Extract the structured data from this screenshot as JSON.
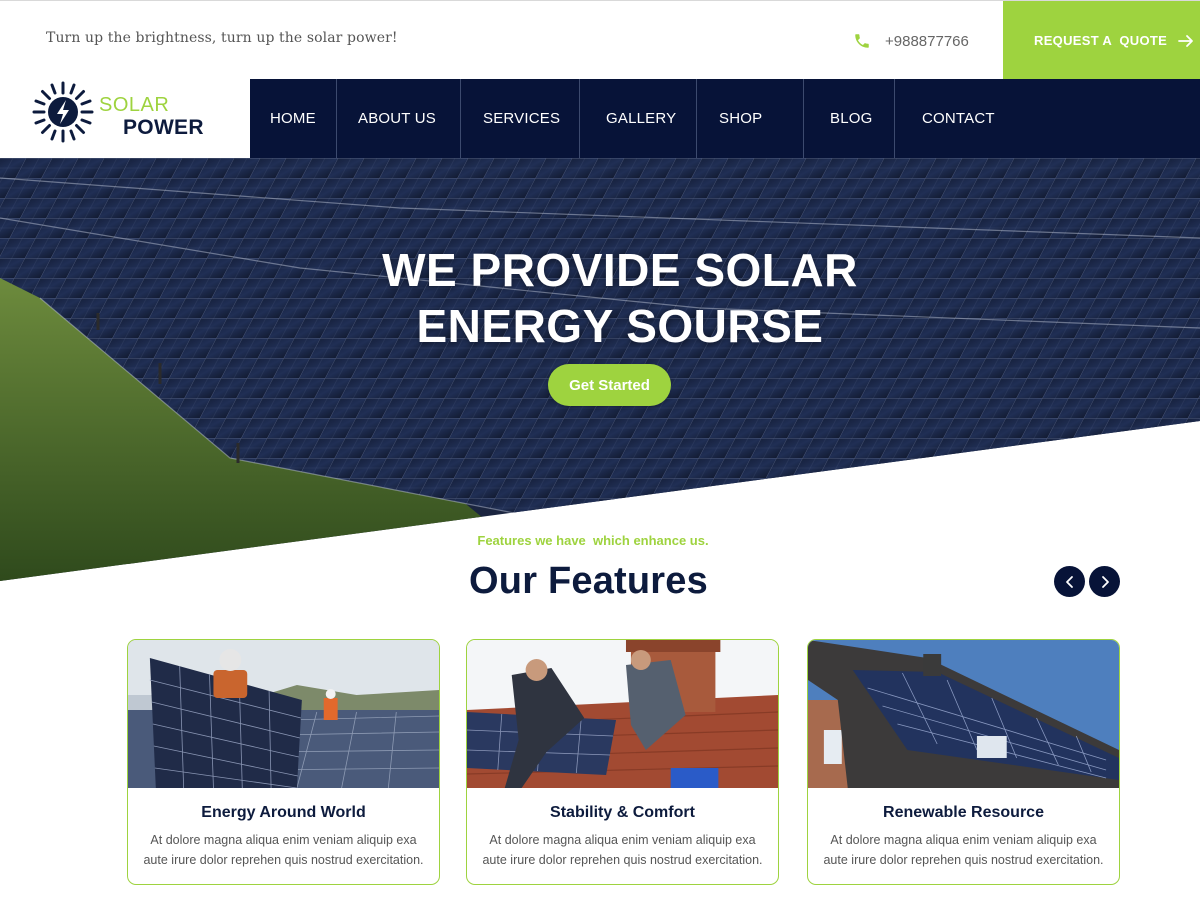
{
  "topbar": {
    "tagline": "Turn up the brightness, turn up the solar power!",
    "phone": "+988877766",
    "phone_icon": "phone-icon",
    "quote_label": "REQUEST A  QUOTE",
    "quote_icon": "arrow-right-icon"
  },
  "logo": {
    "line1": "SOLAR",
    "line2": "POWER",
    "icon": "sun-bolt-icon"
  },
  "nav": {
    "items": [
      "HOME",
      "ABOUT US",
      "SERVICES",
      "GALLERY",
      "SHOP",
      "BLOG",
      "CONTACT"
    ]
  },
  "hero": {
    "title_line1": "WE PROVIDE SOLAR",
    "title_line2": "ENERGY SOURSE",
    "button": "Get Started"
  },
  "features": {
    "subtitle": "Features we have  which enhance us.",
    "title": "Our Features",
    "prev_icon": "chevron-left-icon",
    "next_icon": "chevron-right-icon",
    "cards": [
      {
        "title": "Energy Around World",
        "text": "At dolore magna aliqua enim veniam aliquip exa aute irure dolor reprehen quis nostrud exercitation."
      },
      {
        "title": "Stability & Comfort",
        "text": "At dolore magna aliqua enim veniam aliquip exa aute irure dolor reprehen quis nostrud exercitation."
      },
      {
        "title": "Renewable Resource",
        "text": "At dolore magna aliqua enim veniam aliquip exa aute irure dolor reprehen quis nostrud exercitation."
      }
    ]
  },
  "colors": {
    "accent": "#9ed33f",
    "navy": "#071338",
    "heading": "#0d1b3d"
  }
}
